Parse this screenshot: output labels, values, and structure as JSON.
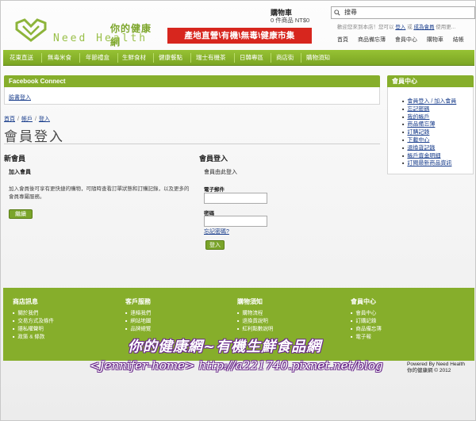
{
  "header": {
    "logo_cn": "你的健康網",
    "logo_en": "Need Health",
    "banner": "產地直營\\有機\\無毒\\健康市集",
    "cart_title": "購物車",
    "cart_info": "0 件商品 NT$0",
    "search_value": "搜尋",
    "welcome_prefix": "歡迎您來到本店！您可以",
    "welcome_login": "登入",
    "welcome_mid": "或",
    "welcome_register": "成為會員",
    "welcome_suffix": "使用更...",
    "top_links": [
      "首頁",
      "商品備忘薄",
      "會員中心",
      "購物車",
      "結帳"
    ]
  },
  "nav": [
    "花東直送",
    "無毒米食",
    "年節禮盒",
    "生鮮食材",
    "健康餐點",
    "瑞士有機茶",
    "日韓專區",
    "商店街",
    "購物須知"
  ],
  "facebook": {
    "title": "Facebook Connect",
    "login": "臉書登入"
  },
  "breadcrumb": [
    "首頁",
    "帳戶",
    "登入"
  ],
  "page_title": "會員登入",
  "new_member": {
    "heading": "新會員",
    "sub": "加入會員",
    "desc": "加入會員後可享有更快捷的購物，可隨時查看訂單狀態和訂購記錄，以及更多的會員專屬服務。",
    "button": "繼續"
  },
  "login": {
    "heading": "會員登入",
    "sub": "會員由此登入",
    "email_label": "電子郵件",
    "password_label": "密碼",
    "forgot": "忘記密碼?",
    "button": "登入"
  },
  "member_center": {
    "title": "會員中心",
    "items": [
      "會員登入 / 加入會員",
      "忘記密碼",
      "我的帳戶",
      "商品備忘薄",
      "訂購記錄",
      "下載中心",
      "退換貨記錄",
      "帳戶資金明細",
      "訂閱最新商品資訊"
    ]
  },
  "footer": {
    "columns": [
      {
        "title": "商店訊息",
        "items": [
          "關於我們",
          "交易方式及條件",
          "隱私權聲明",
          "政策 & 條款"
        ]
      },
      {
        "title": "客戶服務",
        "items": [
          "連絡我們",
          "網站地圖",
          "品牌總覽"
        ]
      },
      {
        "title": "購物須知",
        "items": [
          "購物流程",
          "退換貨說明",
          "紅利點數說明"
        ]
      },
      {
        "title": "會員中心",
        "items": [
          "會員中心",
          "訂購記錄",
          "商品備忘薄",
          "電子報"
        ]
      }
    ],
    "powered_by": "Powered By Need Health",
    "copyright": "你的健康網 © 2012"
  },
  "watermark": {
    "line1": "你的健康網~有機生鮮食品網",
    "line2": "<Jennifer-home> http://a221740.pixnet.net/blog"
  }
}
